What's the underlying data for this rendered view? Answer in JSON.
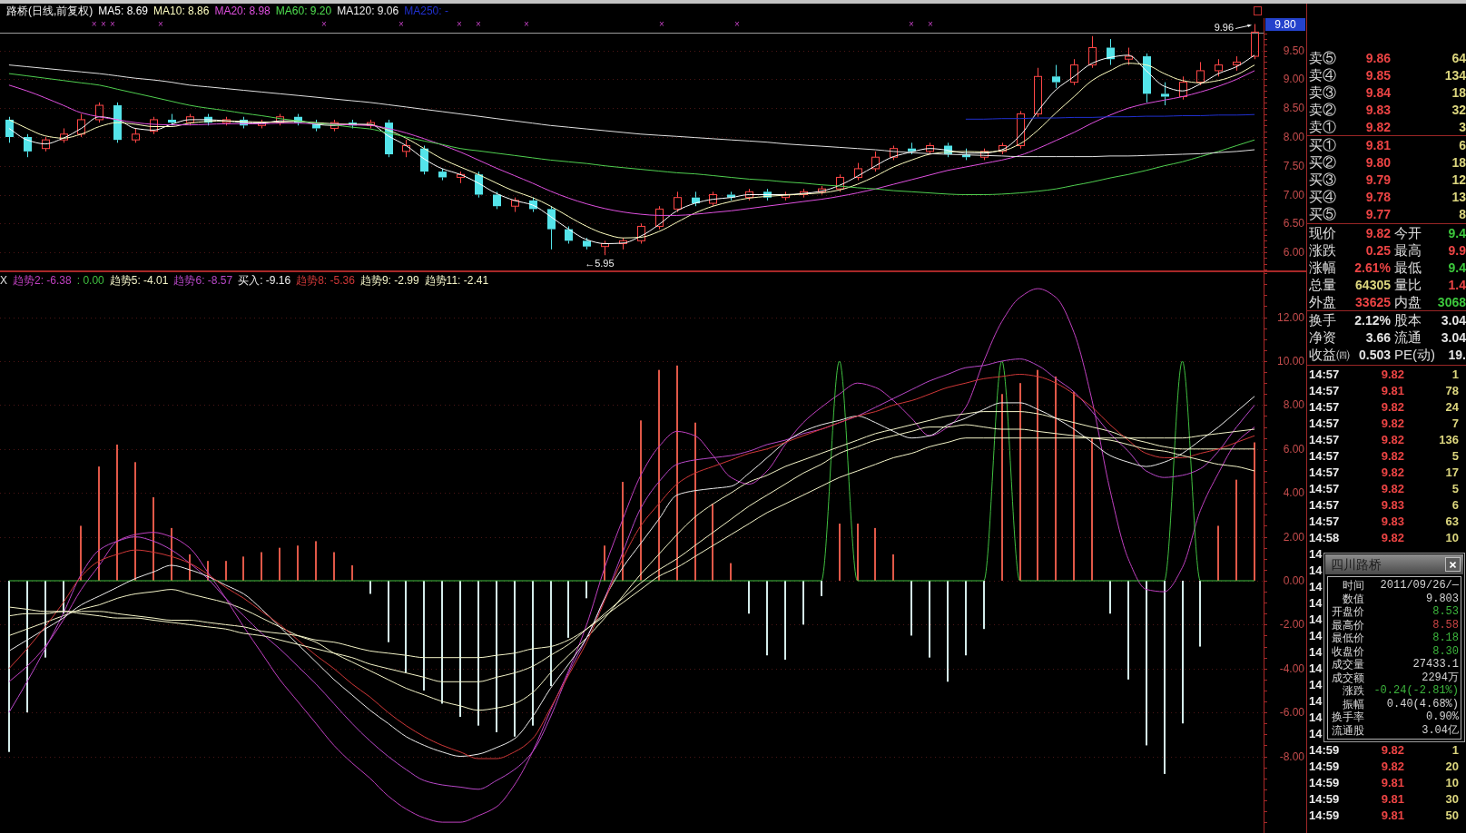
{
  "header": {
    "title": "路桥(日线,前复权)",
    "legend": [
      {
        "text": "MA5: 8.69",
        "color": "#ffffff"
      },
      {
        "text": "MA10: 8.86",
        "color": "#ffffc0"
      },
      {
        "text": "MA20: 8.98",
        "color": "#e050e0"
      },
      {
        "text": "MA60: 9.20",
        "color": "#50e050"
      },
      {
        "text": "MA120: 9.06",
        "color": "#f0f0f0"
      },
      {
        "text": "MA250: -",
        "color": "#2030d0"
      }
    ]
  },
  "price_chart": {
    "event_markers": [
      "×",
      "×",
      "×",
      "×",
      "×",
      "×",
      "×",
      "×",
      "×",
      "×",
      "×",
      "×",
      "×"
    ],
    "axis_tag": "9.80",
    "high_label": "9.96",
    "low_label": "←5.95",
    "chart_data": {
      "type": "candlestick",
      "grid": true,
      "ylim": [
        5.67,
        9.81
      ],
      "yticks": [
        {
          "value": 6,
          "label": "6.00"
        },
        {
          "value": 6.5,
          "label": "6.50"
        },
        {
          "value": 7,
          "label": "7.00"
        },
        {
          "value": 7.5,
          "label": "7.50"
        },
        {
          "value": 8,
          "label": "8.00"
        },
        {
          "value": 8.5,
          "label": "8.50"
        },
        {
          "value": 9,
          "label": "9.00"
        },
        {
          "value": 9.5,
          "label": "9.50"
        }
      ],
      "ohlc": [
        [
          8.3,
          8.35,
          7.9,
          8.0
        ],
        [
          8.0,
          8.05,
          7.65,
          7.75
        ],
        [
          7.8,
          8.0,
          7.75,
          7.95
        ],
        [
          7.95,
          8.15,
          7.9,
          8.05
        ],
        [
          8.05,
          8.4,
          8.0,
          8.3
        ],
        [
          8.3,
          8.6,
          8.25,
          8.55
        ],
        [
          8.55,
          8.6,
          7.9,
          7.95
        ],
        [
          7.95,
          8.15,
          7.9,
          8.05
        ],
        [
          8.1,
          8.35,
          8.05,
          8.3
        ],
        [
          8.3,
          8.4,
          8.2,
          8.25
        ],
        [
          8.25,
          8.4,
          8.2,
          8.35
        ],
        [
          8.35,
          8.4,
          8.2,
          8.25
        ],
        [
          8.25,
          8.35,
          8.2,
          8.3
        ],
        [
          8.3,
          8.35,
          8.15,
          8.2
        ],
        [
          8.2,
          8.3,
          8.15,
          8.25
        ],
        [
          8.25,
          8.4,
          8.2,
          8.35
        ],
        [
          8.35,
          8.4,
          8.2,
          8.25
        ],
        [
          8.25,
          8.3,
          8.1,
          8.15
        ],
        [
          8.15,
          8.3,
          8.1,
          8.25
        ],
        [
          8.25,
          8.3,
          8.15,
          8.2
        ],
        [
          8.2,
          8.3,
          8.15,
          8.25
        ],
        [
          8.25,
          8.3,
          7.65,
          7.7
        ],
        [
          7.75,
          7.95,
          7.65,
          7.85
        ],
        [
          7.8,
          7.85,
          7.35,
          7.4
        ],
        [
          7.4,
          7.45,
          7.25,
          7.3
        ],
        [
          7.3,
          7.4,
          7.2,
          7.35
        ],
        [
          7.35,
          7.4,
          6.95,
          7.0
        ],
        [
          7.0,
          7.05,
          6.75,
          6.8
        ],
        [
          6.8,
          6.95,
          6.7,
          6.9
        ],
        [
          6.9,
          6.95,
          6.7,
          6.75
        ],
        [
          6.75,
          6.8,
          6.05,
          6.4
        ],
        [
          6.4,
          6.45,
          6.15,
          6.2
        ],
        [
          6.2,
          6.25,
          6.05,
          6.1
        ],
        [
          6.1,
          6.2,
          5.95,
          6.15
        ],
        [
          6.15,
          6.25,
          6.05,
          6.2
        ],
        [
          6.2,
          6.5,
          6.15,
          6.45
        ],
        [
          6.45,
          6.8,
          6.4,
          6.75
        ],
        [
          6.75,
          7.05,
          6.7,
          6.95
        ],
        [
          6.95,
          7.05,
          6.8,
          6.85
        ],
        [
          6.85,
          7.05,
          6.8,
          7.0
        ],
        [
          7.0,
          7.05,
          6.9,
          6.95
        ],
        [
          6.95,
          7.1,
          6.9,
          7.05
        ],
        [
          7.05,
          7.1,
          6.9,
          6.95
        ],
        [
          6.95,
          7.05,
          6.9,
          7.0
        ],
        [
          7.0,
          7.1,
          6.95,
          7.05
        ],
        [
          7.05,
          7.15,
          7.0,
          7.1
        ],
        [
          7.1,
          7.35,
          7.05,
          7.3
        ],
        [
          7.3,
          7.55,
          7.25,
          7.45
        ],
        [
          7.45,
          7.75,
          7.4,
          7.65
        ],
        [
          7.65,
          7.85,
          7.6,
          7.8
        ],
        [
          7.8,
          7.9,
          7.7,
          7.75
        ],
        [
          7.75,
          7.9,
          7.7,
          7.85
        ],
        [
          7.85,
          7.9,
          7.65,
          7.7
        ],
        [
          7.7,
          7.8,
          7.6,
          7.65
        ],
        [
          7.65,
          7.8,
          7.6,
          7.75
        ],
        [
          7.75,
          7.9,
          7.7,
          7.85
        ],
        [
          7.85,
          8.45,
          7.8,
          8.4
        ],
        [
          8.4,
          9.2,
          8.35,
          9.05
        ],
        [
          9.05,
          9.25,
          8.85,
          8.95
        ],
        [
          8.95,
          9.35,
          8.9,
          9.25
        ],
        [
          9.25,
          9.75,
          9.2,
          9.55
        ],
        [
          9.55,
          9.7,
          9.25,
          9.35
        ],
        [
          9.35,
          9.55,
          9.25,
          9.4
        ],
        [
          9.4,
          9.45,
          8.6,
          8.75
        ],
        [
          8.75,
          8.95,
          8.55,
          8.7
        ],
        [
          8.7,
          9.05,
          8.65,
          8.95
        ],
        [
          8.95,
          9.3,
          8.9,
          9.15
        ],
        [
          9.15,
          9.35,
          9.05,
          9.25
        ],
        [
          9.25,
          9.4,
          9.15,
          9.3
        ],
        [
          9.4,
          9.96,
          9.35,
          9.82
        ]
      ],
      "series": [
        {
          "type": "line",
          "color": "#ffffff",
          "values": [
            8.15,
            7.95,
            7.88,
            7.98,
            8.15,
            8.35,
            8.3,
            8.15,
            8.12,
            8.22,
            8.3,
            8.3,
            8.28,
            8.25,
            8.24,
            8.28,
            8.28,
            8.22,
            8.2,
            8.22,
            8.22,
            8.02,
            7.85,
            7.62,
            7.45,
            7.35,
            7.2,
            7.02,
            6.9,
            6.82,
            6.62,
            6.4,
            6.22,
            6.15,
            6.16,
            6.28,
            6.48,
            6.72,
            6.85,
            6.92,
            6.95,
            7.0,
            7.0,
            7.0,
            7.02,
            7.06,
            7.16,
            7.32,
            7.5,
            7.66,
            7.74,
            7.8,
            7.77,
            7.72,
            7.72,
            7.78,
            8.02,
            8.45,
            8.82,
            9.05,
            9.28,
            9.38,
            9.42,
            9.15,
            8.88,
            8.8,
            8.92,
            9.1,
            9.22,
            9.42
          ]
        },
        {
          "type": "line",
          "color": "#ffffc0",
          "values": [
            8.3,
            8.15,
            8.02,
            7.98,
            8.05,
            8.18,
            8.25,
            8.22,
            8.18,
            8.18,
            8.24,
            8.27,
            8.28,
            8.27,
            8.26,
            8.26,
            8.27,
            8.25,
            8.23,
            8.22,
            8.21,
            8.12,
            7.98,
            7.8,
            7.62,
            7.48,
            7.35,
            7.2,
            7.06,
            6.95,
            6.8,
            6.62,
            6.45,
            6.32,
            6.25,
            6.26,
            6.36,
            6.52,
            6.68,
            6.8,
            6.88,
            6.94,
            6.97,
            6.99,
            7.01,
            7.03,
            7.08,
            7.18,
            7.32,
            7.48,
            7.6,
            7.7,
            7.74,
            7.75,
            7.74,
            7.76,
            7.88,
            8.12,
            8.42,
            8.7,
            8.98,
            9.15,
            9.28,
            9.25,
            9.1,
            8.98,
            8.94,
            8.98,
            9.08,
            9.25
          ]
        },
        {
          "type": "line",
          "color": "#e050e0",
          "values": [
            8.9,
            8.8,
            8.68,
            8.55,
            8.42,
            8.35,
            8.3,
            8.25,
            8.22,
            8.21,
            8.21,
            8.22,
            8.23,
            8.23,
            8.23,
            8.24,
            8.24,
            8.23,
            8.22,
            8.21,
            8.2,
            8.15,
            8.07,
            7.97,
            7.86,
            7.74,
            7.6,
            7.46,
            7.33,
            7.2,
            7.06,
            6.94,
            6.84,
            6.76,
            6.7,
            6.66,
            6.64,
            6.64,
            6.66,
            6.69,
            6.72,
            6.76,
            6.8,
            6.84,
            6.88,
            6.92,
            6.97,
            7.03,
            7.1,
            7.18,
            7.26,
            7.34,
            7.42,
            7.48,
            7.54,
            7.6,
            7.68,
            7.8,
            7.94,
            8.08,
            8.24,
            8.38,
            8.5,
            8.58,
            8.64,
            8.7,
            8.78,
            8.88,
            9.0,
            9.15
          ]
        },
        {
          "type": "line",
          "color": "#50d050",
          "values": [
            9.1,
            9.06,
            9.02,
            8.98,
            8.94,
            8.9,
            8.83,
            8.76,
            8.69,
            8.62,
            8.55,
            8.5,
            8.46,
            8.41,
            8.37,
            8.32,
            8.28,
            8.24,
            8.21,
            8.17,
            8.14,
            8.07,
            8.0,
            7.93,
            7.87,
            7.8,
            7.76,
            7.72,
            7.68,
            7.64,
            7.6,
            7.57,
            7.54,
            7.5,
            7.47,
            7.44,
            7.41,
            7.38,
            7.36,
            7.33,
            7.3,
            7.27,
            7.25,
            7.22,
            7.2,
            7.17,
            7.15,
            7.12,
            7.1,
            7.07,
            7.05,
            7.03,
            7.01,
            7.0,
            7.0,
            7.01,
            7.03,
            7.06,
            7.1,
            7.16,
            7.22,
            7.29,
            7.35,
            7.42,
            7.5,
            7.57,
            7.66,
            7.75,
            7.85,
            7.95
          ]
        },
        {
          "type": "line",
          "color": "#e0e0e0",
          "values": [
            9.25,
            9.22,
            9.19,
            9.16,
            9.13,
            9.1,
            9.06,
            9.02,
            8.99,
            8.95,
            8.9,
            8.87,
            8.84,
            8.81,
            8.78,
            8.75,
            8.72,
            8.69,
            8.66,
            8.63,
            8.6,
            8.56,
            8.52,
            8.48,
            8.44,
            8.4,
            8.36,
            8.32,
            8.28,
            8.24,
            8.2,
            8.17,
            8.14,
            8.11,
            8.08,
            8.05,
            8.03,
            8.01,
            7.99,
            7.97,
            7.95,
            7.93,
            7.91,
            7.88,
            7.86,
            7.84,
            7.82,
            7.8,
            7.78,
            7.75,
            7.73,
            7.71,
            7.7,
            7.69,
            7.68,
            7.67,
            7.66,
            7.66,
            7.66,
            7.66,
            7.66,
            7.67,
            7.67,
            7.68,
            7.69,
            7.7,
            7.71,
            7.73,
            7.75,
            7.78
          ]
        },
        {
          "type": "line",
          "color": "#2030d0",
          "values": [
            null,
            null,
            null,
            null,
            null,
            null,
            null,
            null,
            null,
            null,
            null,
            null,
            null,
            null,
            null,
            null,
            null,
            null,
            null,
            null,
            null,
            null,
            null,
            null,
            null,
            null,
            null,
            null,
            null,
            null,
            null,
            null,
            null,
            null,
            null,
            null,
            null,
            null,
            null,
            null,
            null,
            null,
            null,
            null,
            null,
            null,
            null,
            null,
            null,
            null,
            null,
            null,
            null,
            8.31,
            8.31,
            8.32,
            8.32,
            8.33,
            8.33,
            8.34,
            8.34,
            8.35,
            8.35,
            8.36,
            8.36,
            8.37,
            8.37,
            8.38,
            8.38,
            8.39
          ]
        }
      ]
    }
  },
  "indicator": {
    "legend": [
      {
        "text": "X",
        "color": "#e0e0e0"
      },
      {
        "text": "趋势2: -6.38",
        "color": "#c040c0"
      },
      {
        "text": ": 0.00",
        "color": "#40c040"
      },
      {
        "text": "趋势5: -4.01",
        "color": "#f4f4c8"
      },
      {
        "text": "趋势6: -8.57",
        "color": "#b848c8"
      },
      {
        "text": "买入: -9.16",
        "color": "#ececec"
      },
      {
        "text": "趋势8: -5.36",
        "color": "#d03838"
      },
      {
        "text": "趋势9: -2.99",
        "color": "#f4f4c8"
      },
      {
        "text": "趋势11: -2.41",
        "color": "#f4f4c8"
      }
    ],
    "chart_data": {
      "type": "line",
      "grid": true,
      "ylim": [
        -11.49,
        14.09
      ],
      "yticks": [
        {
          "value": -8,
          "label": "-8.00"
        },
        {
          "value": -6,
          "label": "-6.00"
        },
        {
          "value": -4,
          "label": "-4.00"
        },
        {
          "value": -2,
          "label": "-2.00"
        },
        {
          "value": 0,
          "label": "0.00"
        },
        {
          "value": 2,
          "label": "2.00"
        },
        {
          "value": 4,
          "label": "4.00"
        },
        {
          "value": 6,
          "label": "6.00"
        },
        {
          "value": 8,
          "label": "8.00"
        },
        {
          "value": 10,
          "label": "10.00"
        },
        {
          "value": 12,
          "label": "12.00"
        }
      ],
      "series": [
        {
          "type": "bar",
          "color": "#e05848",
          "values": [
            null,
            null,
            null,
            null,
            2.5,
            5.2,
            6.2,
            5.4,
            3.8,
            2.4,
            1.2,
            0.9,
            0.9,
            1.1,
            1.3,
            1.5,
            1.6,
            1.8,
            1.3,
            0.7,
            null,
            null,
            null,
            null,
            null,
            null,
            null,
            null,
            null,
            null,
            null,
            null,
            null,
            1.6,
            4.5,
            7.3,
            9.6,
            9.8,
            7.2,
            3.5,
            0.8,
            null,
            null,
            null,
            null,
            null,
            2.6,
            2.6,
            2.4,
            1.2,
            null,
            null,
            null,
            null,
            null,
            8.5,
            9.0,
            9.6,
            9.3,
            8.6,
            6.5,
            null,
            null,
            null,
            null,
            null,
            null,
            2.5,
            4.6,
            6.3
          ]
        },
        {
          "type": "bar",
          "color": "#d4ecea",
          "values": [
            -7.8,
            -6.0,
            -3.5,
            -1.5,
            null,
            null,
            null,
            null,
            null,
            null,
            null,
            null,
            null,
            null,
            null,
            null,
            null,
            null,
            null,
            null,
            -0.6,
            -2.8,
            -4.2,
            -5.0,
            -5.6,
            -6.2,
            -6.6,
            -6.9,
            -7.1,
            -6.6,
            -4.8,
            -2.6,
            -0.8,
            null,
            null,
            null,
            null,
            null,
            null,
            null,
            null,
            -1.5,
            -3.4,
            -3.6,
            -2.0,
            -0.7,
            null,
            null,
            null,
            null,
            -2.5,
            -3.5,
            -4.6,
            -3.4,
            -2.2,
            null,
            null,
            null,
            null,
            null,
            null,
            -1.5,
            -4.5,
            -7.5,
            -8.8,
            -6.5,
            -3.0,
            null,
            null,
            null
          ]
        },
        {
          "color": "#c040c0",
          "values": [
            -4.6,
            -3.9,
            -3.0,
            -1.8,
            -0.4,
            0.7,
            1.8,
            2.1,
            2.2,
            2.0,
            1.5,
            0.4,
            -0.8,
            -2.1,
            -3.3,
            -4.5,
            -5.5,
            -6.5,
            -7.5,
            -8.3,
            -9.0,
            -9.8,
            -10.4,
            -10.8,
            -11.0,
            -11.0,
            -10.7,
            -10.3,
            -9.3,
            -7.8,
            -5.9,
            -4.1,
            -2.0,
            0.6,
            2.8,
            4.8,
            6.1,
            6.8,
            6.6,
            5.7,
            4.7,
            4.4,
            5.0,
            6.2,
            7.2,
            7.9,
            8.5,
            9.0,
            8.8,
            8.2,
            7.4,
            6.6,
            7.0,
            7.9,
            10.0,
            11.8,
            12.9,
            13.3,
            12.9,
            11.3,
            8.2,
            4.1,
            1.0,
            -0.4,
            -0.5,
            0.6,
            3.2,
            4.9,
            6.3,
            7.0
          ]
        },
        {
          "color": "#40c040",
          "values": [
            0,
            0,
            0,
            0,
            0,
            0,
            0,
            0,
            0,
            0,
            0,
            0,
            0,
            0,
            0,
            0,
            0,
            0,
            0,
            0,
            0,
            0,
            0,
            0,
            0,
            0,
            0,
            0,
            0,
            0,
            0,
            0,
            0,
            0,
            0,
            0,
            0,
            0,
            0,
            0,
            0,
            0,
            0,
            0,
            0,
            0,
            10,
            0,
            0,
            0,
            0,
            0,
            0,
            0,
            0,
            10,
            0,
            0,
            0,
            0,
            0,
            0,
            0,
            0,
            0,
            10,
            0,
            0,
            0,
            0
          ]
        },
        {
          "color": "#f4f4c8",
          "values": [
            -2.5,
            -2.2,
            -1.9,
            -1.6,
            -1.3,
            -1.1,
            -0.8,
            -0.6,
            -0.5,
            -0.4,
            -0.6,
            -0.8,
            -1.0,
            -1.3,
            -1.7,
            -2.1,
            -2.5,
            -2.8,
            -3.3,
            -3.7,
            -4.1,
            -4.5,
            -4.9,
            -5.2,
            -5.5,
            -5.7,
            -5.9,
            -5.8,
            -5.6,
            -5.1,
            -4.2,
            -3.4,
            -2.6,
            -1.7,
            -0.7,
            0.3,
            1.2,
            2.1,
            2.9,
            3.5,
            4.0,
            4.5,
            4.8,
            5.2,
            5.5,
            5.8,
            6.1,
            6.4,
            6.7,
            6.9,
            7.1,
            7.3,
            7.5,
            7.6,
            7.7,
            7.7,
            7.7,
            7.6,
            7.4,
            7.2,
            7.0,
            6.8,
            6.5,
            6.3,
            6.1,
            6.0,
            6.0,
            6.0,
            6.0,
            6.0
          ]
        },
        {
          "color": "#b848c8",
          "values": [
            -6.0,
            -4.6,
            -3.1,
            -1.5,
            0.3,
            1.4,
            1.8,
            2.0,
            1.8,
            1.4,
            0.8,
            0.1,
            -0.8,
            -1.6,
            -2.4,
            -3.1,
            -3.9,
            -4.7,
            -5.6,
            -6.5,
            -7.3,
            -8.0,
            -8.6,
            -9.1,
            -9.3,
            -9.4,
            -9.5,
            -9.1,
            -8.6,
            -7.8,
            -6.2,
            -4.2,
            -2.6,
            -0.8,
            1.3,
            3.3,
            4.5,
            5.3,
            5.5,
            5.6,
            5.7,
            5.9,
            6.2,
            6.4,
            6.7,
            6.9,
            7.2,
            7.5,
            7.9,
            8.3,
            8.7,
            9.1,
            9.4,
            9.7,
            9.8,
            10.0,
            10.1,
            9.8,
            9.2,
            8.6,
            7.7,
            6.7,
            5.9,
            5.0,
            4.7,
            4.8,
            5.1,
            5.9,
            7.0,
            8.0
          ]
        },
        {
          "color": "#ececec",
          "values": [
            -3.2,
            -2.7,
            -2.2,
            -1.7,
            -1.1,
            -0.7,
            -0.3,
            0.1,
            0.4,
            0.7,
            0.5,
            0.2,
            -0.2,
            -0.6,
            -1.3,
            -2.1,
            -2.9,
            -3.7,
            -4.5,
            -5.2,
            -5.9,
            -6.5,
            -7.1,
            -7.5,
            -7.8,
            -8.0,
            -7.9,
            -7.6,
            -7.2,
            -6.2,
            -4.9,
            -3.8,
            -2.6,
            -0.8,
            0.6,
            1.7,
            2.8,
            3.9,
            4.1,
            4.2,
            4.3,
            4.9,
            5.6,
            6.3,
            6.8,
            7.1,
            7.3,
            7.5,
            7.2,
            6.8,
            6.5,
            6.6,
            7.1,
            7.4,
            7.8,
            8.1,
            8.1,
            7.8,
            7.4,
            6.9,
            6.3,
            5.7,
            5.4,
            5.2,
            5.4,
            5.8,
            6.4,
            7.0,
            7.7,
            8.4
          ]
        },
        {
          "color": "#d03838",
          "values": [
            -4.0,
            -3.1,
            -2.1,
            -1.0,
            0.2,
            0.9,
            1.2,
            1.4,
            1.3,
            1.1,
            0.8,
            0.3,
            -0.3,
            -0.8,
            -1.4,
            -2.0,
            -2.7,
            -3.4,
            -4.0,
            -4.7,
            -5.3,
            -6.0,
            -6.6,
            -7.1,
            -7.5,
            -7.8,
            -8.1,
            -8.1,
            -7.8,
            -7.2,
            -5.8,
            -4.3,
            -2.8,
            -0.9,
            1.0,
            2.5,
            3.5,
            4.4,
            4.9,
            5.2,
            5.5,
            5.8,
            6.0,
            6.3,
            6.6,
            6.9,
            7.2,
            7.5,
            7.7,
            8.0,
            8.2,
            8.5,
            8.8,
            9.0,
            9.2,
            9.3,
            9.4,
            9.3,
            9.0,
            8.5,
            7.9,
            7.1,
            6.4,
            5.8,
            5.6,
            5.6,
            5.8,
            6.0,
            6.3,
            6.6
          ]
        },
        {
          "color": "#f4f4c8",
          "values": [
            -1.2,
            -1.3,
            -1.4,
            -1.4,
            -1.5,
            -1.6,
            -1.7,
            -1.7,
            -1.8,
            -1.9,
            -2.0,
            -2.1,
            -2.2,
            -2.4,
            -2.5,
            -2.7,
            -2.9,
            -3.1,
            -3.3,
            -3.5,
            -3.8,
            -4.0,
            -4.2,
            -4.4,
            -4.6,
            -4.6,
            -4.6,
            -4.4,
            -4.2,
            -3.9,
            -3.4,
            -2.9,
            -2.2,
            -1.5,
            -0.8,
            -0.1,
            0.5,
            1.0,
            1.6,
            2.2,
            2.8,
            3.4,
            3.9,
            4.4,
            4.9,
            5.3,
            5.8,
            6.1,
            6.4,
            6.6,
            6.8,
            7.0,
            7.0,
            7.1,
            7.0,
            6.9,
            6.9,
            6.8,
            6.7,
            6.6,
            6.5,
            6.4,
            6.2,
            6.0,
            5.9,
            5.7,
            5.5,
            5.3,
            5.2,
            5.0
          ]
        },
        {
          "color": "#f4f4c8",
          "values": [
            -1.6,
            -1.5,
            -1.5,
            -1.4,
            -1.4,
            -1.4,
            -1.5,
            -1.6,
            -1.7,
            -1.8,
            -1.8,
            -1.9,
            -2.0,
            -2.1,
            -2.3,
            -2.4,
            -2.5,
            -2.7,
            -2.8,
            -3.0,
            -3.2,
            -3.3,
            -3.4,
            -3.5,
            -3.5,
            -3.5,
            -3.5,
            -3.4,
            -3.3,
            -3.1,
            -3.0,
            -2.7,
            -2.2,
            -1.6,
            -1.0,
            -0.4,
            0.2,
            0.6,
            1.1,
            1.6,
            2.1,
            2.6,
            3.1,
            3.5,
            3.9,
            4.3,
            4.7,
            5.0,
            5.3,
            5.6,
            5.8,
            6.1,
            6.3,
            6.5,
            6.5,
            6.5,
            6.5,
            6.5,
            6.5,
            6.5,
            6.5,
            6.5,
            6.5,
            6.5,
            6.5,
            6.5,
            6.6,
            6.7,
            6.8,
            6.9
          ]
        }
      ]
    }
  },
  "order_book": {
    "asks": [
      {
        "label": "卖⑤",
        "price": "9.86",
        "volume": "64"
      },
      {
        "label": "卖④",
        "price": "9.85",
        "volume": "134"
      },
      {
        "label": "卖③",
        "price": "9.84",
        "volume": "18"
      },
      {
        "label": "卖②",
        "price": "9.83",
        "volume": "32"
      },
      {
        "label": "卖①",
        "price": "9.82",
        "volume": "3"
      }
    ],
    "bids": [
      {
        "label": "买①",
        "price": "9.81",
        "volume": "6"
      },
      {
        "label": "买②",
        "price": "9.80",
        "volume": "18"
      },
      {
        "label": "买③",
        "price": "9.79",
        "volume": "12"
      },
      {
        "label": "买④",
        "price": "9.78",
        "volume": "13"
      },
      {
        "label": "买⑤",
        "price": "9.77",
        "volume": "8"
      }
    ]
  },
  "market_stats": [
    {
      "label": "现价",
      "value": "9.82",
      "color": "#ec4444"
    },
    {
      "label": "今开",
      "value": "9.4",
      "color": "#3cc83c"
    },
    {
      "label": "涨跌",
      "value": "0.25",
      "color": "#ec4444"
    },
    {
      "label": "最高",
      "value": "9.9",
      "color": "#ec4444"
    },
    {
      "label": "涨幅",
      "value": "2.61%",
      "color": "#ec4444"
    },
    {
      "label": "最低",
      "value": "9.4",
      "color": "#3cc83c"
    },
    {
      "label": "总量",
      "value": "64305",
      "color": "#dcd67e"
    },
    {
      "label": "量比",
      "value": "1.4",
      "color": "#ec4444"
    },
    {
      "label": "外盘",
      "value": "33625",
      "color": "#ec4444"
    },
    {
      "label": "内盘",
      "value": "3068",
      "color": "#3cc83c"
    }
  ],
  "share_stats": [
    {
      "label": "换手",
      "value": "2.12%"
    },
    {
      "label": "股本",
      "value": "3.04"
    },
    {
      "label": "净资",
      "value": "3.66"
    },
    {
      "label": "流通",
      "value": "3.04"
    },
    {
      "label": "收益㈣",
      "value": "0.503"
    },
    {
      "label": "PE(动)",
      "value": "19."
    }
  ],
  "trades": [
    {
      "time": "14:57",
      "price": "9.82",
      "volume": "1"
    },
    {
      "time": "14:57",
      "price": "9.81",
      "volume": "78"
    },
    {
      "time": "14:57",
      "price": "9.82",
      "volume": "24"
    },
    {
      "time": "14:57",
      "price": "9.82",
      "volume": "7"
    },
    {
      "time": "14:57",
      "price": "9.82",
      "volume": "136"
    },
    {
      "time": "14:57",
      "price": "9.82",
      "volume": "5"
    },
    {
      "time": "14:57",
      "price": "9.82",
      "volume": "17"
    },
    {
      "time": "14:57",
      "price": "9.82",
      "volume": "5"
    },
    {
      "time": "14:57",
      "price": "9.83",
      "volume": "6"
    },
    {
      "time": "14:57",
      "price": "9.83",
      "volume": "63"
    },
    {
      "time": "14:58",
      "price": "9.82",
      "volume": "10"
    },
    {
      "time": "14"
    },
    {
      "time": "14"
    },
    {
      "time": "14"
    },
    {
      "time": "14"
    },
    {
      "time": "14"
    },
    {
      "time": "14"
    },
    {
      "time": "14"
    },
    {
      "time": "14"
    },
    {
      "time": "14"
    },
    {
      "time": "14"
    },
    {
      "time": "14"
    },
    {
      "time": "14"
    },
    {
      "time": "14:59",
      "price": "9.82",
      "volume": "1"
    },
    {
      "time": "14:59",
      "price": "9.82",
      "volume": "20"
    },
    {
      "time": "14:59",
      "price": "9.81",
      "volume": "10"
    },
    {
      "time": "14:59",
      "price": "9.81",
      "volume": "30"
    },
    {
      "time": "14:59",
      "price": "9.81",
      "volume": "50"
    }
  ],
  "tooltip": {
    "title": "四川路桥",
    "rows": [
      {
        "label": "时间",
        "value": "2011/09/26/—",
        "color": "#d4d4d4"
      },
      {
        "label": "数值",
        "value": "9.803",
        "color": "#d4d4d4"
      },
      {
        "label": "开盘价",
        "value": "8.53",
        "color": "#3cb43c"
      },
      {
        "label": "最高价",
        "value": "8.58",
        "color": "#c84444"
      },
      {
        "label": "最低价",
        "value": "8.18",
        "color": "#3cb43c"
      },
      {
        "label": "收盘价",
        "value": "8.30",
        "color": "#3cb43c"
      },
      {
        "label": "成交量",
        "value": "27433.1",
        "color": "#d4d4d4"
      },
      {
        "label": "成交额",
        "value": "2294万",
        "color": "#d4d4d4"
      },
      {
        "label": "涨跌",
        "value": "-0.24(-2.81%)",
        "color": "#3cb43c"
      },
      {
        "label": "振幅",
        "value": "0.40(4.68%)",
        "color": "#d4d4d4"
      },
      {
        "label": "换手率",
        "value": "0.90%",
        "color": "#d4d4d4"
      },
      {
        "label": "流通股",
        "value": "3.04亿",
        "color": "#d4d4d4"
      }
    ]
  }
}
